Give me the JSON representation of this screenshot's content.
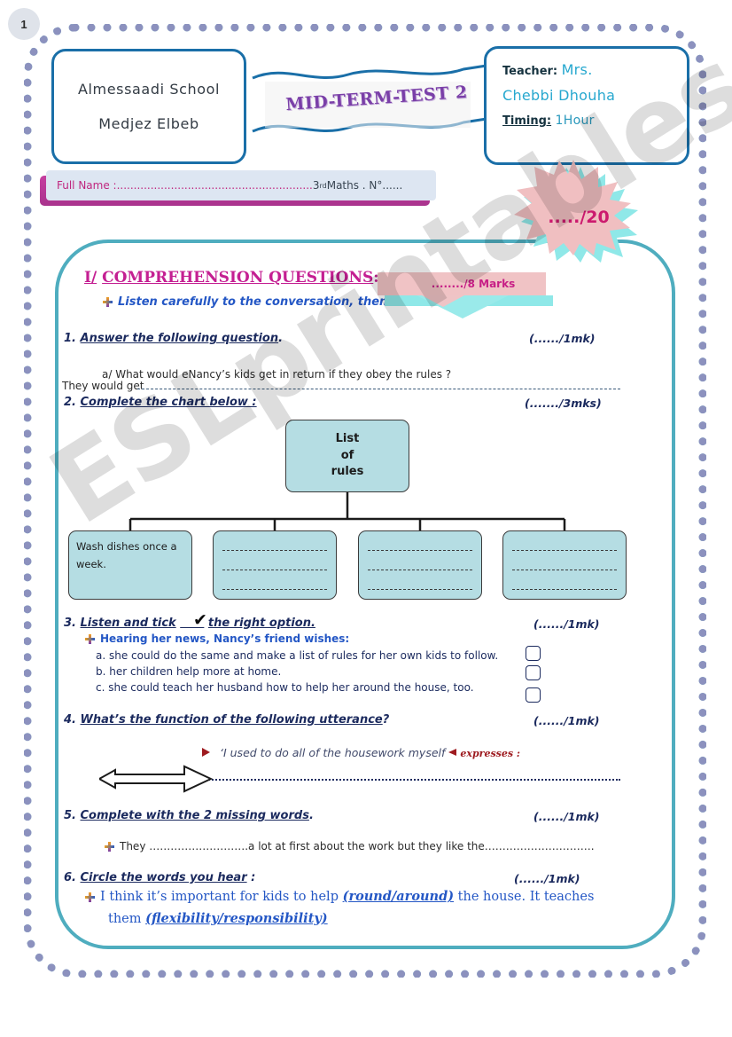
{
  "page": {
    "number": "1"
  },
  "header": {
    "school": {
      "line1": "Almessaadi School",
      "line2": "Medjez Elbeb"
    },
    "ribbon_title": "MID-TERM-TEST 2",
    "teacher_label": "Teacher:",
    "teacher_name": "Mrs.",
    "teacher_name2": "Chebbi Dhouha",
    "timing_label": "Timing:",
    "timing_value": "1Hour",
    "score_badge": "...../20"
  },
  "fullname": {
    "label": "Full Name :",
    "dots": "..........................................................",
    "class": "3",
    "class_sup": "rd",
    "class_rest": "Maths . N°......"
  },
  "section": {
    "number": "I/",
    "title": "COMPREHENSION QUESTIONS",
    "colon": ":",
    "marks": "......../8 Marks",
    "instruction": "Listen carefully to the conversation, then."
  },
  "questions": [
    {
      "num": "1.",
      "title": "Answer the following question",
      "suffix": ".",
      "marks": "(....../1mk)",
      "sub_a": "a/ What would eNancy’s kids  get in return  if they obey the rules ?",
      "answer_lead": "They would get"
    },
    {
      "num": "2.",
      "title": "Complete the chart below :",
      "marks": "(......./3mks)"
    },
    {
      "num": "3.",
      "title_a": "Listen and tick",
      "title_b": "the right option.",
      "marks": "(....../1mk)",
      "prompt": "Hearing her news, Nancy’s friend wishes:",
      "options": [
        "a. she could do the same and make a list of rules for her own kids to follow.",
        "b. her children help more at home.",
        "c. she could teach her husband how to help her around the house, too."
      ]
    },
    {
      "num": "4.",
      "title": "What’s the function of the following utterance",
      "suffix": "?",
      "marks": "(....../1mk)",
      "quote": "‘I used to do all of the housework myself",
      "expresses": "expresses :"
    },
    {
      "num": "5.",
      "title": "Complete with the 2 missing words",
      "suffix": ".",
      "marks": "(....../1mk)",
      "body": "They ……………………….a lot at first about the work but they like the…………………………."
    },
    {
      "num": "6.",
      "title": "Circle the words you hear",
      "suffix": ":",
      "marks": "(....../1mk)",
      "line1_a": "I think it’s important for kids to help ",
      "line1_b": "(round/around)",
      "line1_c": " the house. It teaches",
      "line2_a": "them ",
      "line2_b": "(flexibility/responsibility)"
    }
  ],
  "chart_data": {
    "type": "diagram",
    "title": "List of rules",
    "root": {
      "lines": [
        "List",
        "of",
        "rules"
      ]
    },
    "children": [
      {
        "filled": true,
        "text": "Wash dishes once a week.",
        "blank_lines": 0
      },
      {
        "filled": false,
        "text": "",
        "blank_lines": 3
      },
      {
        "filled": false,
        "text": "",
        "blank_lines": 3
      },
      {
        "filled": false,
        "text": "",
        "blank_lines": 3
      }
    ],
    "box_fill": "#b5dde3",
    "connector_color": "#1b1b1b"
  },
  "watermark": {
    "text": "ESLprintables.com"
  },
  "colors": {
    "frame_teal": "#2fe3d0",
    "frame_pink": "#d94fb0",
    "header_blue": "#1a6fa8",
    "content_teal": "#4fadbf",
    "magenta": "#c41f92",
    "navy": "#1b2a5e",
    "chart_fill": "#b5dde3",
    "burst_pink": "#f0bfc1",
    "burst_cyan": "#8fe8e8"
  }
}
